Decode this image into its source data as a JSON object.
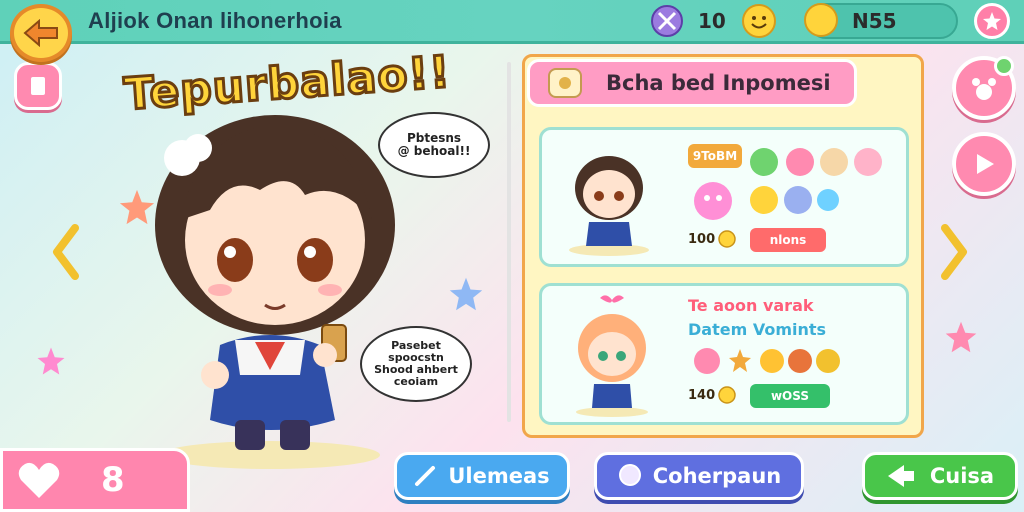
{
  "header": {
    "title": "Aljiok Onan lihonerhoia",
    "stat1_value": "10",
    "coin_value": "N55"
  },
  "main": {
    "big_title": "Tepurbalao!!",
    "bubble_top": [
      "Pbtesns",
      "@ behoal!!"
    ],
    "bubble_bottom": [
      "Pasebet",
      "spoocstn",
      "Shood ahbert",
      "ceoiam"
    ]
  },
  "panel": {
    "header_label": "Bcha bed Inpomesi",
    "card1": {
      "label_small": "9ToBM",
      "number": "100",
      "button_label": "nlons"
    },
    "card2": {
      "title_line1": "Te aoon varak",
      "title_line2": "Datem Vomints",
      "number": "140",
      "button_label": "wOSS"
    }
  },
  "footer": {
    "lives": "8",
    "btn_left": "Ulemeas",
    "btn_mid": "Coherpaun",
    "btn_right": "Cuisa"
  },
  "colors": {
    "topbar": "#5fd1b9",
    "pink": "#ff8ab0",
    "panel_bg": "#fff6c2",
    "blue_btn": "#4aa9f0",
    "purple_btn": "#5f6fe0",
    "green_btn": "#49c64a"
  }
}
